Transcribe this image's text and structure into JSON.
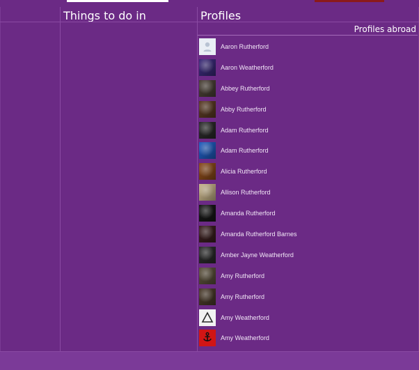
{
  "columns": {
    "things": {
      "title": "Things to do in"
    },
    "profiles": {
      "title": "Profiles",
      "subtitle": "Profiles abroad",
      "items": [
        {
          "name": "Aaron Rutherford",
          "avatar": "placeholder-person-icon",
          "color": "#e9eef5"
        },
        {
          "name": "Aaron Weatherford",
          "avatar": "concert-photo",
          "color": "#3b2a7a"
        },
        {
          "name": "Abbey Rutherford",
          "avatar": "portrait-photo",
          "color": "#4a4036"
        },
        {
          "name": "Abby Rutherford",
          "avatar": "portrait-photo",
          "color": "#5a3a24"
        },
        {
          "name": "Adam Rutherford",
          "avatar": "portrait-photo",
          "color": "#2a2a2a"
        },
        {
          "name": "Adam Rutherford",
          "avatar": "blue-light-photo",
          "color": "#1f5cc0"
        },
        {
          "name": "Alicia Rutherford",
          "avatar": "portrait-photo",
          "color": "#8a4a1a"
        },
        {
          "name": "Allison Rutherford",
          "avatar": "portrait-photo",
          "color": "#c7b38a"
        },
        {
          "name": "Amanda Rutherford",
          "avatar": "portrait-photo",
          "color": "#171717"
        },
        {
          "name": "Amanda Rutherford Barnes",
          "avatar": "portrait-photo",
          "color": "#3a1f1f"
        },
        {
          "name": "Amber Jayne Weatherford",
          "avatar": "portrait-photo",
          "color": "#2b2b2b"
        },
        {
          "name": "Amy Rutherford",
          "avatar": "portrait-photo",
          "color": "#5a4f3a"
        },
        {
          "name": "Amy Rutherford",
          "avatar": "portrait-photo",
          "color": "#4a3a2a"
        },
        {
          "name": "Amy Weatherford",
          "avatar": "triangle-logo",
          "color": "#f2f2f2"
        },
        {
          "name": "Amy Weatherford",
          "avatar": "anchor-logo",
          "color": "#d11515"
        }
      ]
    }
  },
  "colors": {
    "background": "#6b2a85",
    "divider": "#8a4aa3"
  }
}
